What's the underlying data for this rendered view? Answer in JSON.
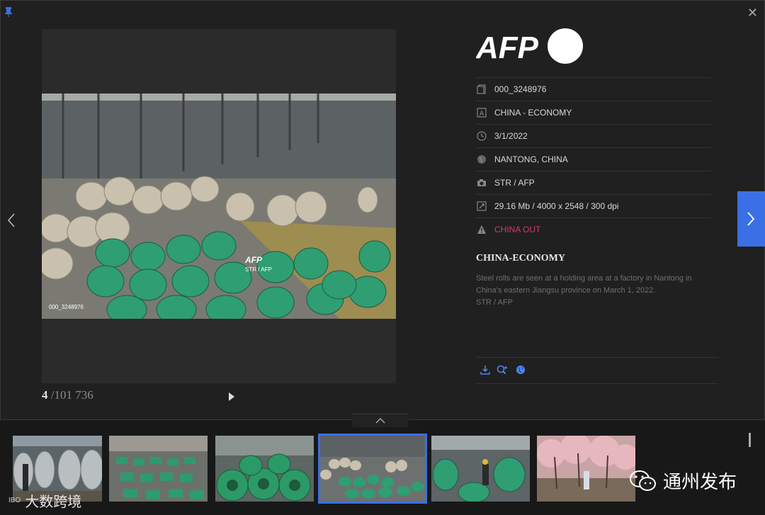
{
  "window": {
    "close_icon": "close-icon",
    "pin_icon": "pin-icon"
  },
  "viewer": {
    "counter_current": "4",
    "counter_total": " /101 736",
    "watermark_id": "000_3248976",
    "watermark_logo": "AFP",
    "watermark_credit": "STR / AFP"
  },
  "agency": {
    "logo_text": "AFP"
  },
  "metadata": [
    {
      "icon": "document-icon",
      "text": "000_3248976"
    },
    {
      "icon": "category-icon",
      "text": "CHINA - ECONOMY"
    },
    {
      "icon": "clock-icon",
      "text": "3/1/2022"
    },
    {
      "icon": "globe-icon",
      "text": "NANTONG, CHINA"
    },
    {
      "icon": "camera-icon",
      "text": "STR / AFP"
    },
    {
      "icon": "resize-icon",
      "text": "29.16 Mb / 4000 x 2548 / 300 dpi"
    },
    {
      "icon": "warning-icon",
      "text": "CHINA OUT",
      "color": "#d23b6a"
    }
  ],
  "story": {
    "title": "CHINA-ECONOMY",
    "caption_line1": "Steel rolls are seen at a holding area at a factory in Nantong in China's eastern Jiangsu province on March 1, 2022.",
    "caption_line2": "STR / AFP"
  },
  "actions": [
    "download-icon",
    "zoom-in-icon",
    "web-icon"
  ],
  "thumbnails": [
    "thumb-1",
    "thumb-2",
    "thumb-3",
    "thumb-4-selected",
    "thumb-5",
    "thumb-6"
  ],
  "overlays": {
    "left_brand": "大数跨境",
    "left_brand_mini": "IBO",
    "right_brand": "通州发布"
  },
  "colors": {
    "accent": "#3b6fe6",
    "alert": "#d23b6a",
    "background": "#202020"
  }
}
